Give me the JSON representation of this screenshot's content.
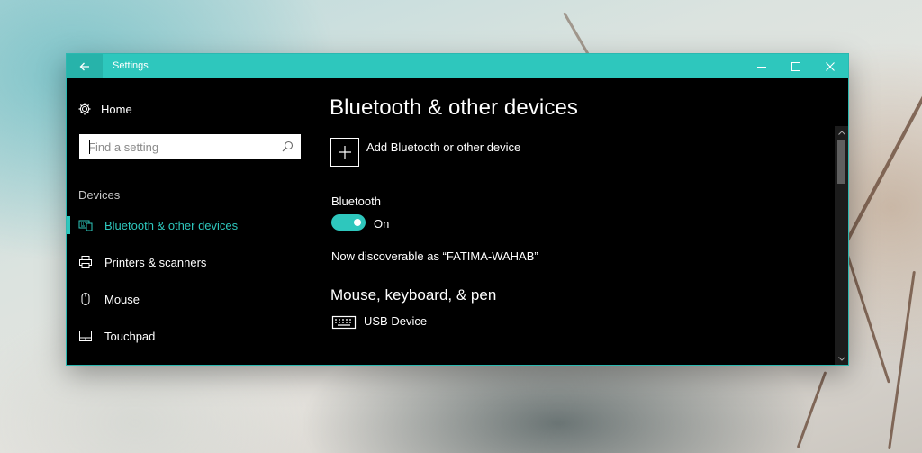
{
  "window": {
    "title": "Settings",
    "accent_color": "#2ec7bd",
    "controls": {
      "back": "arrow-left-icon",
      "minimize": "minimize-icon",
      "maximize": "maximize-icon",
      "close": "close-icon"
    }
  },
  "sidebar": {
    "home_label": "Home",
    "search_placeholder": "Find a setting",
    "section_header": "Devices",
    "items": [
      {
        "label": "Bluetooth & other devices",
        "icon": "bluetooth-devices-icon",
        "active": true
      },
      {
        "label": "Printers & scanners",
        "icon": "printer-icon",
        "active": false
      },
      {
        "label": "Mouse",
        "icon": "mouse-icon",
        "active": false
      },
      {
        "label": "Touchpad",
        "icon": "touchpad-icon",
        "active": false
      }
    ]
  },
  "main": {
    "title": "Bluetooth & other devices",
    "add_device_label": "Add Bluetooth or other device",
    "bluetooth_header": "Bluetooth",
    "bluetooth_state": "On",
    "bluetooth_on": true,
    "discoverable_text": "Now discoverable as “FATIMA-WAHAB”",
    "section_mkp": "Mouse, keyboard, & pen",
    "device_name": "USB Device",
    "device_icon": "keyboard-icon"
  }
}
